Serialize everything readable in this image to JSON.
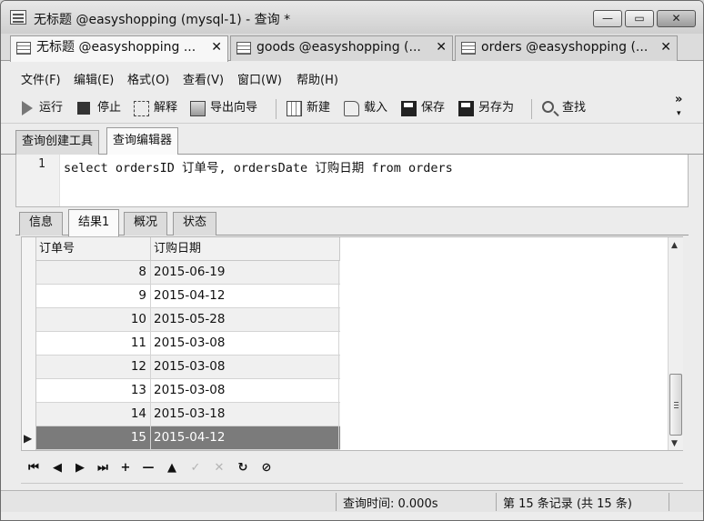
{
  "window": {
    "title": "无标题 @easyshopping (mysql-1) - 查询 *",
    "minimize": "—",
    "maximize": "▭",
    "close": "✕"
  },
  "doc_tabs": [
    {
      "label": "无标题 @easyshopping ...",
      "close": "✕"
    },
    {
      "label": "goods @easyshopping (...",
      "close": "✕"
    },
    {
      "label": "orders @easyshopping (...",
      "close": "✕"
    }
  ],
  "menu": [
    "文件(F)",
    "编辑(E)",
    "格式(O)",
    "查看(V)",
    "窗口(W)",
    "帮助(H)"
  ],
  "toolbar": {
    "run": "运行",
    "stop": "停止",
    "explain": "解释",
    "export_wizard": "导出向导",
    "new": "新建",
    "load": "载入",
    "save": "保存",
    "save_as": "另存为",
    "find": "查找",
    "overflow": "»",
    "overflow_down": "▾"
  },
  "editor_tabs": [
    "查询创建工具",
    "查询编辑器"
  ],
  "editor": {
    "line_number": "1",
    "sql": "select ordersID 订单号, ordersDate 订购日期 from orders"
  },
  "result_tabs": [
    "信息",
    "结果1",
    "概况",
    "状态"
  ],
  "grid": {
    "columns": [
      "订单号",
      "订购日期"
    ],
    "rows": [
      {
        "id": "8",
        "date": "2015-06-19"
      },
      {
        "id": "9",
        "date": "2015-04-12"
      },
      {
        "id": "10",
        "date": "2015-05-28"
      },
      {
        "id": "11",
        "date": "2015-03-08"
      },
      {
        "id": "12",
        "date": "2015-03-08"
      },
      {
        "id": "13",
        "date": "2015-03-08"
      },
      {
        "id": "14",
        "date": "2015-03-18"
      },
      {
        "id": "15",
        "date": "2015-04-12"
      }
    ],
    "current_row_marker": "▶",
    "scroll_up": "▲",
    "scroll_down": "▼"
  },
  "nav_buttons": [
    {
      "name": "first-record-icon",
      "glyph": "⏮"
    },
    {
      "name": "previous-record-icon",
      "glyph": "◀"
    },
    {
      "name": "next-record-icon",
      "glyph": "▶"
    },
    {
      "name": "last-record-icon",
      "glyph": "⏭"
    },
    {
      "name": "add-record-icon",
      "glyph": "+"
    },
    {
      "name": "delete-record-icon",
      "glyph": "—"
    },
    {
      "name": "scroll-top-icon",
      "glyph": "▲"
    },
    {
      "name": "apply-changes-icon",
      "glyph": "✓"
    },
    {
      "name": "discard-changes-icon",
      "glyph": "✕"
    },
    {
      "name": "refresh-icon",
      "glyph": "↻"
    },
    {
      "name": "stop-icon",
      "glyph": "⊘"
    }
  ],
  "status": {
    "query_time": "查询时间: 0.000s",
    "record_info": "第 15 条记录 (共 15 条)"
  }
}
